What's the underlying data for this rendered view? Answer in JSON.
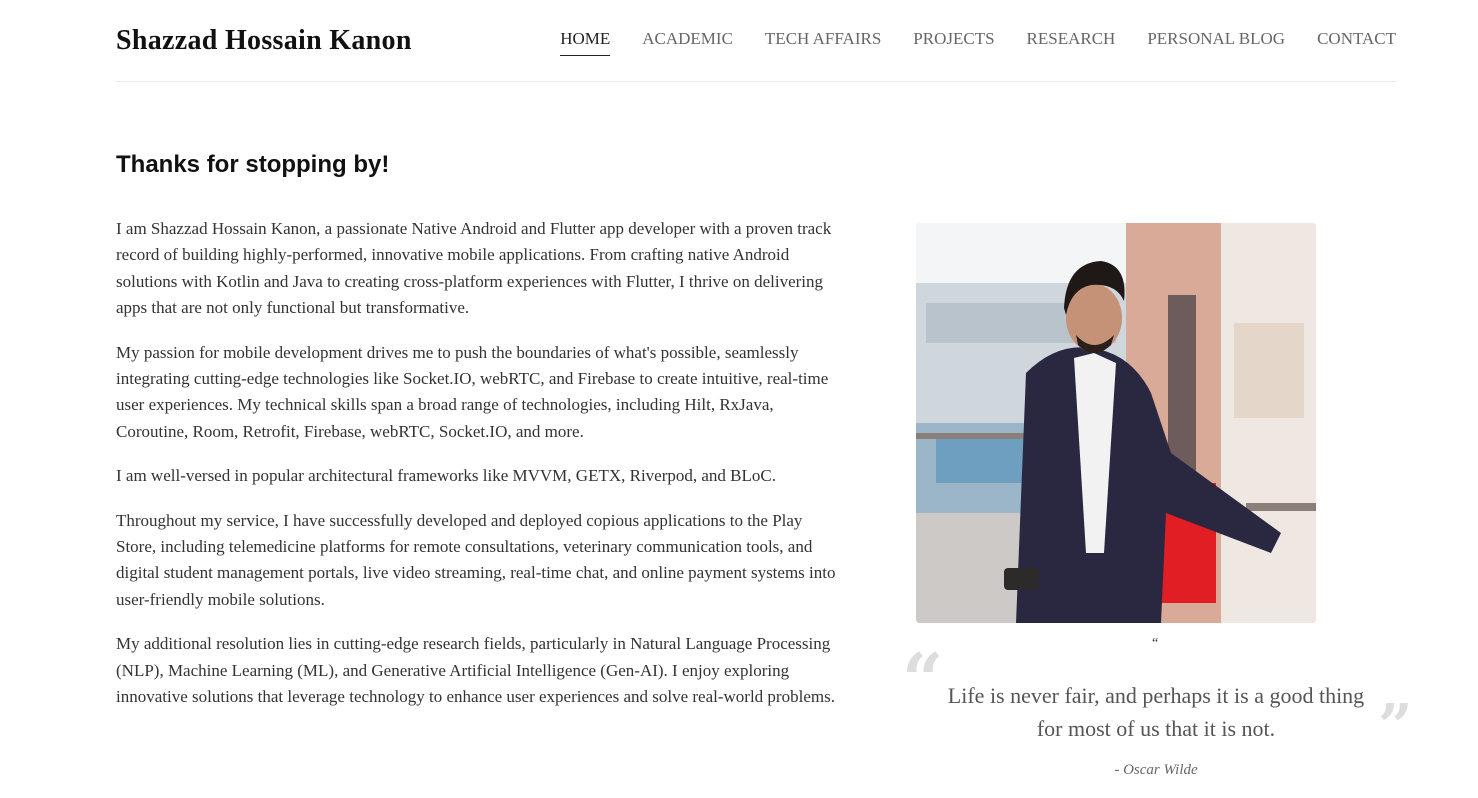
{
  "header": {
    "site_title": "Shazzad Hossain Kanon",
    "nav": [
      {
        "label": "HOME",
        "active": true
      },
      {
        "label": "ACADEMIC",
        "active": false
      },
      {
        "label": "TECH AFFAIRS",
        "active": false
      },
      {
        "label": "PROJECTS",
        "active": false
      },
      {
        "label": "RESEARCH",
        "active": false
      },
      {
        "label": "PERSONAL BLOG",
        "active": false
      },
      {
        "label": "CONTACT",
        "active": false
      }
    ]
  },
  "main": {
    "heading": "Thanks for stopping by!",
    "paragraphs": [
      "I am Shazzad Hossain Kanon, a passionate Native Android and Flutter app developer with a proven track record of building highly-performed, innovative mobile applications. From crafting native Android solutions with Kotlin and Java to creating cross-platform experiences with Flutter, I thrive on delivering apps that are not only functional but transformative.",
      "My passion for mobile development drives me to push the boundaries of what's possible, seamlessly integrating cutting-edge technologies like Socket.IO, webRTC, and Firebase to create intuitive, real-time user experiences. My technical skills span a broad range of technologies, including Hilt, RxJava, Coroutine, Room, Retrofit, Firebase, webRTC, Socket.IO, and more.",
      "I am well-versed in popular architectural frameworks like MVVM, GETX, Riverpod, and BLoC.",
      "Throughout my service, I have successfully developed and deployed copious applications to the Play Store, including telemedicine platforms for remote consultations, veterinary communication tools, and digital student management portals, live video streaming, real-time chat, and online payment systems into user-friendly mobile solutions.",
      "My additional resolution lies in cutting-edge research fields, particularly in Natural Language Processing (NLP), Machine Learning (ML), and Generative Artificial Intelligence (Gen-AI). I enjoy exploring innovative solutions that leverage technology to enhance user experiences and solve real-world problems."
    ]
  },
  "quote": {
    "small_mark": "“",
    "open_mark": "“",
    "close_mark": "”",
    "text": "Life is never fair, and perhaps it is a good thing for most of us that it is not.",
    "author": "- Oscar Wilde"
  },
  "colors": {
    "title": "#111111",
    "body_text": "#333333",
    "nav_text": "#666666",
    "quote_marks": "#dddddd"
  }
}
